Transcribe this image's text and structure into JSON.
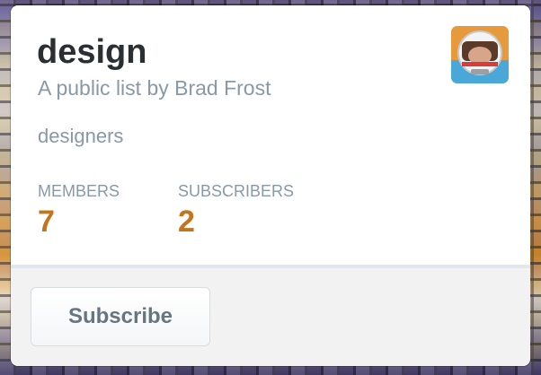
{
  "list": {
    "name": "design",
    "byline": "A public list by Brad Frost",
    "description": "designers"
  },
  "stats": {
    "members_label": "MEMBERS",
    "members_value": "7",
    "subscribers_label": "SUBSCRIBERS",
    "subscribers_value": "2"
  },
  "actions": {
    "subscribe_label": "Subscribe"
  },
  "avatar": {
    "icon": "profile-photo"
  },
  "colors": {
    "title": "#292f33",
    "muted": "#8899a6",
    "stat_value": "#c4741a",
    "footer_background": "#f2f2f2",
    "button_text": "#66757f"
  }
}
